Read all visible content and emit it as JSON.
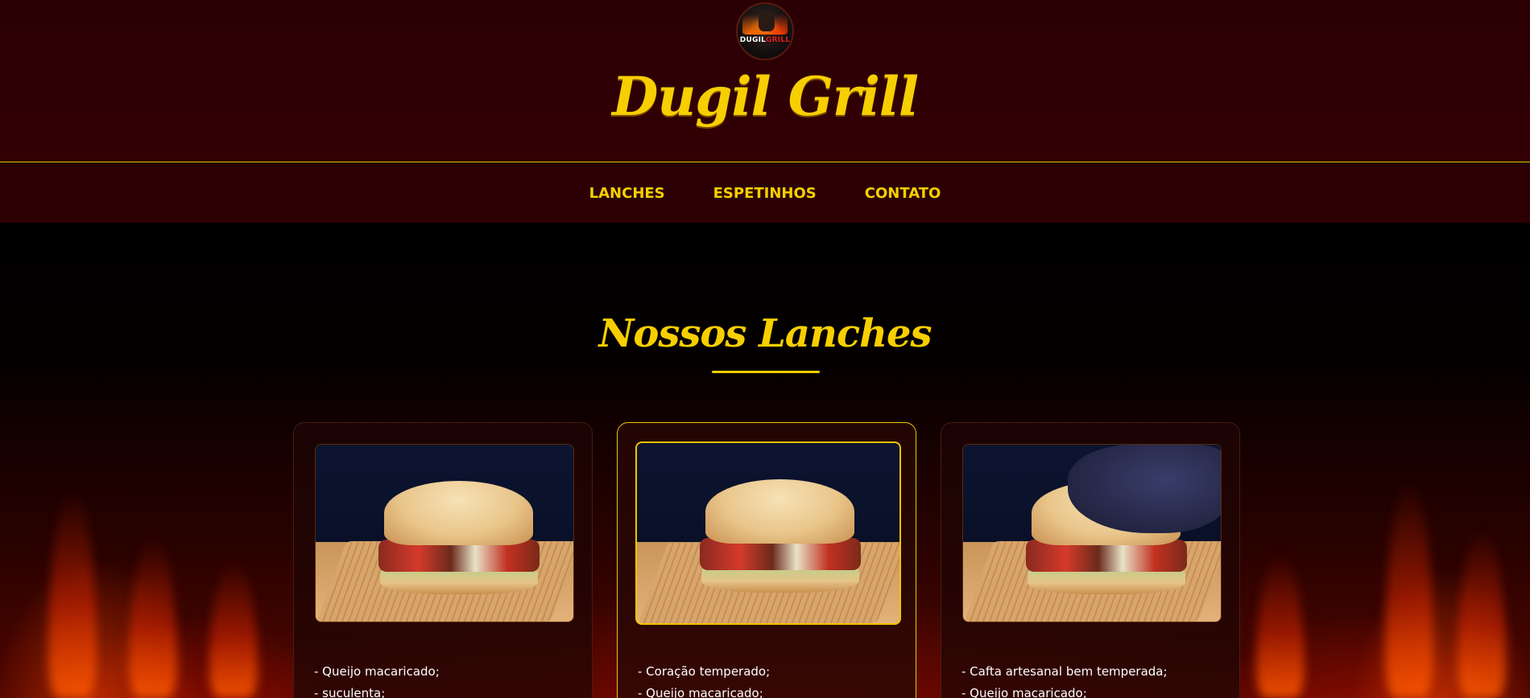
{
  "brand": {
    "logo_text_white": "DUGIL",
    "logo_text_red": "GRILL",
    "title": "Dugil Grill"
  },
  "nav": {
    "items": [
      {
        "label": "LANCHES"
      },
      {
        "label": "ESPETINHOS"
      },
      {
        "label": "CONTATO"
      }
    ]
  },
  "section": {
    "title": "Nossos Lanches"
  },
  "cards": [
    {
      "lines": [
        "- Queijo macaricado;",
        "- suculenta;"
      ]
    },
    {
      "lines": [
        "- Coração temperado;",
        "- Queijo macaricado;"
      ]
    },
    {
      "lines": [
        "- Cafta artesanal bem temperada;",
        "- Queijo macaricado;"
      ]
    }
  ],
  "colors": {
    "accent": "#f7cf00",
    "header_bg": "#2c0003",
    "page_bg": "#000000"
  }
}
